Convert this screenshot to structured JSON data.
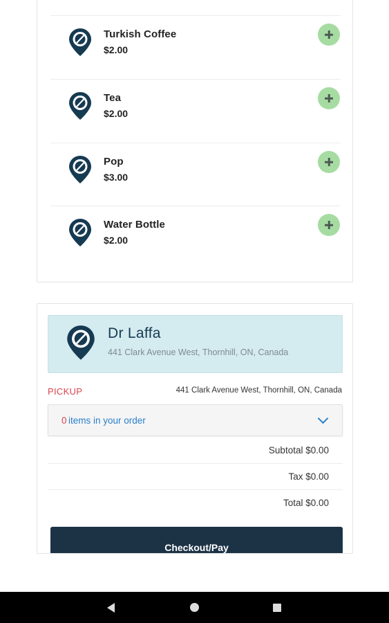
{
  "menu": {
    "items": [
      {
        "name": "Turkish Coffee",
        "price": "$2.00",
        "icon": "location-pin-icon"
      },
      {
        "name": "Tea",
        "price": "$2.00",
        "icon": "location-pin-icon"
      },
      {
        "name": "Pop",
        "price": "$3.00",
        "icon": "location-pin-icon"
      },
      {
        "name": "Water Bottle",
        "price": "$2.00",
        "icon": "location-pin-icon"
      }
    ],
    "add_icon": "plus-icon"
  },
  "order": {
    "store_name": "Dr Laffa",
    "store_address": "441 Clark Avenue West, Thornhill, ON, Canada",
    "pickup_label": "PICKUP",
    "pickup_address": "441 Clark Avenue West, Thornhill, ON, Canada",
    "items_count": "0",
    "items_text": "items in your order",
    "subtotal": "Subtotal $0.00",
    "tax": "Tax $0.00",
    "total": "Total $0.00",
    "checkout_label": "Checkout/Pay"
  },
  "colors": {
    "navy": "#163a52",
    "add_green": "#a6dca2",
    "store_bg": "#d4ebf0",
    "accent_red": "#d9434b",
    "link_blue": "#2a7fc9",
    "button_dark": "#1c3346"
  },
  "system_nav": {
    "back_icon": "back-triangle-icon",
    "home_icon": "home-circle-icon",
    "recents_icon": "recents-square-icon"
  }
}
